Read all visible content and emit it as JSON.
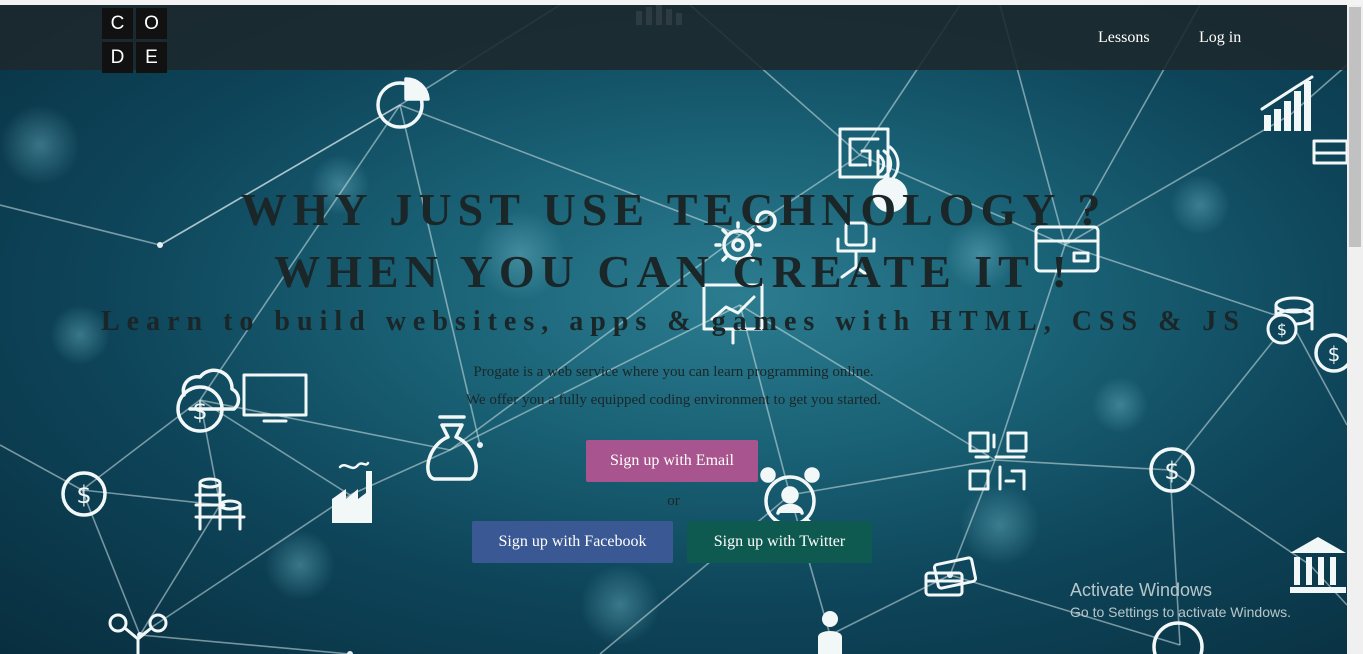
{
  "nav": {
    "logo_letters": [
      "C",
      "O",
      "D",
      "E"
    ],
    "links": [
      "Lessons",
      "Log in"
    ]
  },
  "hero": {
    "headline_line1": "WHY JUST USE TECHNOLOGY ?",
    "headline_line2": "WHEN YOU CAN CREATE IT !",
    "subheadline": "Learn to build websites, apps & games with HTML, CSS & JS",
    "description_line1": "Progate is a web service where you can learn programming online.",
    "description_line2": "We offer you a fully equipped coding environment to get you started.",
    "or_text": "or"
  },
  "buttons": {
    "email": "Sign up with Email",
    "facebook": "Sign up with Facebook",
    "twitter": "Sign up with Twitter"
  },
  "colors": {
    "email_button": "#a8548e",
    "facebook_button": "#3a5893",
    "twitter_button": "#0f5a50",
    "navbar": "#1c282c",
    "headline_text": "#1a2628"
  },
  "watermark": {
    "title": "Activate Windows",
    "subtitle": "Go to Settings to activate Windows."
  },
  "background_icons": [
    "pie-chart-icon",
    "maze-icon",
    "wifi-icon",
    "gear-icon",
    "office-chair-icon",
    "credit-card-icon",
    "growth-chart-icon",
    "coins-icon",
    "dollar-icon",
    "cloud-dollar-icon",
    "monitor-icon",
    "money-bag-icon",
    "factory-icon",
    "qr-code-icon",
    "teamwork-icon",
    "bank-icon",
    "drone-icon",
    "person-icon",
    "analytics-board-icon"
  ]
}
